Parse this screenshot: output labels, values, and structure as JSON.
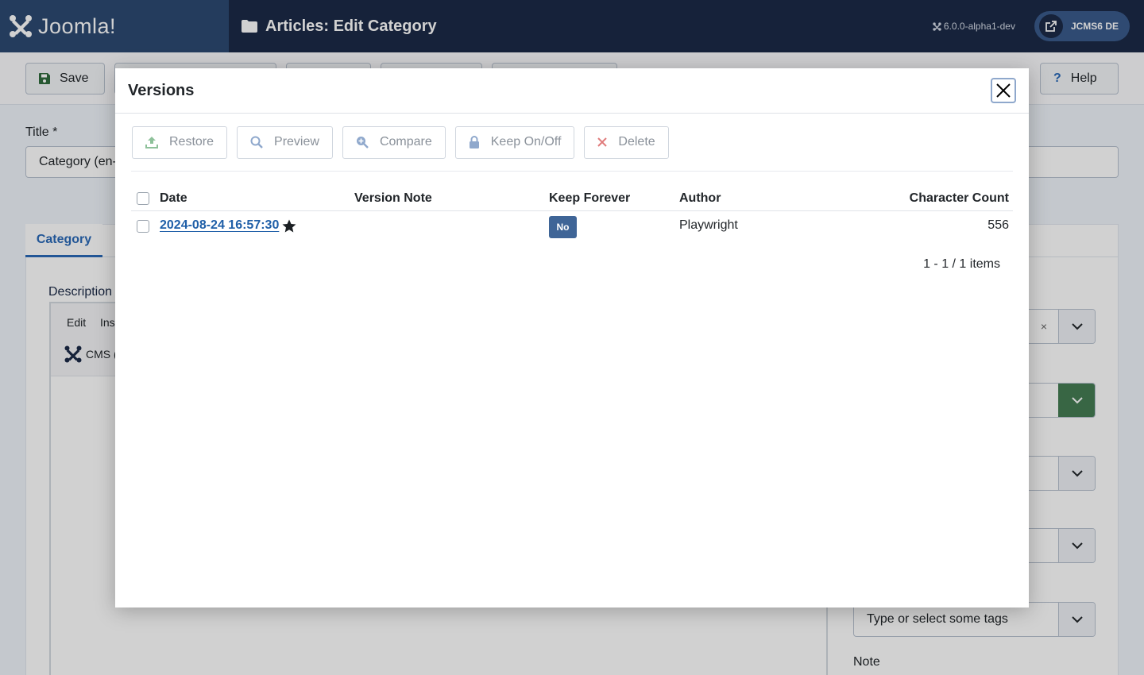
{
  "header": {
    "logo_text": "Joomla!",
    "page_title": "Articles: Edit Category",
    "version": "6.0.0-alpha1-dev",
    "site_label": "JCMS6 DE"
  },
  "toolbar": {
    "save_label": "Save",
    "help_label": "Help"
  },
  "form": {
    "title_label": "Title *",
    "title_value": "Category (en-",
    "tab_category": "Category",
    "description_label": "Description",
    "editor_menu_edit": "Edit",
    "editor_menu_insert": "Ins",
    "editor_cms_label": "CMS (",
    "tags_placeholder": "Type or select some tags",
    "note_label": "Note"
  },
  "modal": {
    "title": "Versions",
    "buttons": {
      "restore": "Restore",
      "preview": "Preview",
      "compare": "Compare",
      "keep": "Keep On/Off",
      "delete": "Delete"
    },
    "columns": {
      "date": "Date",
      "version_note": "Version Note",
      "keep_forever": "Keep Forever",
      "author": "Author",
      "character_count": "Character Count"
    },
    "rows": [
      {
        "date": "2024-08-24 16:57:30",
        "version_note": "",
        "keep_forever": "No",
        "author": "Playwright",
        "character_count": "556"
      }
    ],
    "pagination": "1 - 1 / 1 items"
  },
  "colors": {
    "header_bg": "#1b2a47",
    "brand_bg": "#2d4a72",
    "link": "#1f5fa8",
    "badge": "#3f6597"
  }
}
